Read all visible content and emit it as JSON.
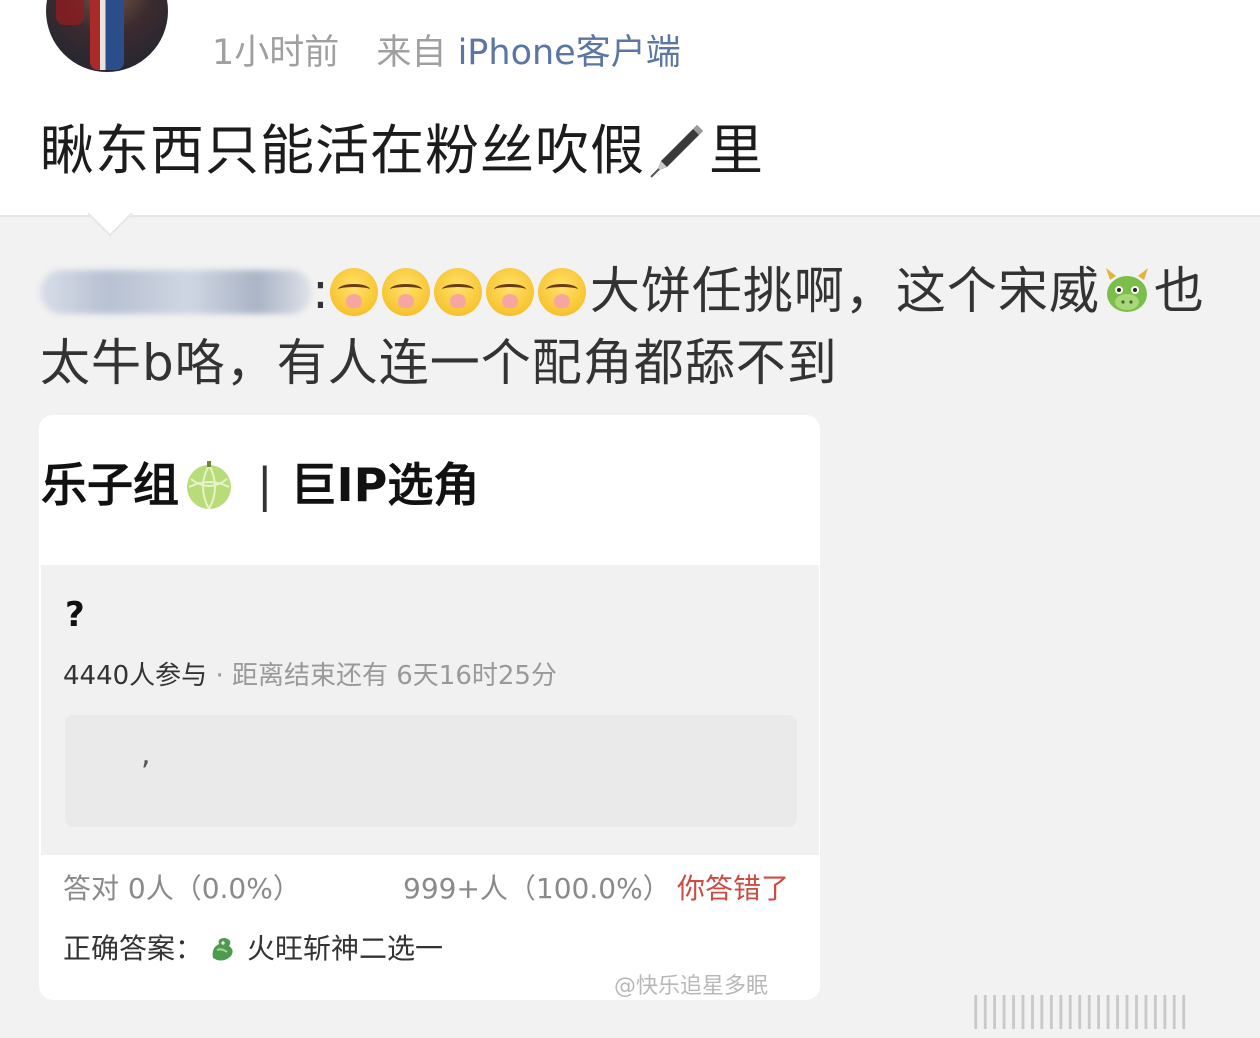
{
  "post": {
    "time": "1小时前",
    "source_prefix": "来自",
    "source": "iPhone客户端",
    "text_before": "瞅东西只能活在粉丝吹假",
    "text_after": "里",
    "inline_icon": "fountain-pen"
  },
  "repost": {
    "mention_icon": "blurred-mention",
    "mention_suffix": ":",
    "emoji_name": "cry-cover-mouth",
    "emoji_count": 5,
    "text_part1": "大饼任挑啊，这个宋威",
    "dragon_icon": "dragon-face",
    "text_part2": "也太牛b咯，有人连一个配角都舔不到"
  },
  "card": {
    "title_part1": "乐子组",
    "melon_icon": "melon",
    "separator": "|",
    "title_part2": "巨IP选角",
    "question": "?",
    "participants": "4440人参与",
    "countdown": "· 距离结束还有 6天16时25分",
    "option_text": ",",
    "correct_stats": "答对  0人（0.0%）",
    "wrong_stats": "999+人（100.0%）",
    "wrong_label": "你答错了",
    "answer_label": "正确答案：",
    "answer_icon": "dragon",
    "answer_text": "火旺斩神二选一",
    "watermark": "@快乐追星多眠"
  },
  "footer_watermark": "|||||||||||||||||||||||",
  "colors": {
    "link": "#5b76a3",
    "wrong_red": "#cc4b43",
    "repost_bg": "#f2f2f2"
  }
}
